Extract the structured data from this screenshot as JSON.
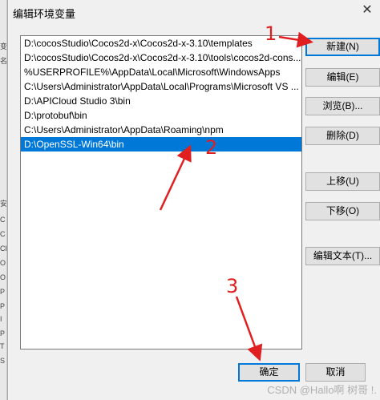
{
  "dialog": {
    "title": "编辑环境变量",
    "close_glyph": "✕"
  },
  "path_list": [
    {
      "text": "D:\\cocosStudio\\Cocos2d-x\\Cocos2d-x-3.10\\templates",
      "selected": false
    },
    {
      "text": "D:\\cocosStudio\\Cocos2d-x\\Cocos2d-x-3.10\\tools\\cocos2d-cons...",
      "selected": false
    },
    {
      "text": "%USERPROFILE%\\AppData\\Local\\Microsoft\\WindowsApps",
      "selected": false
    },
    {
      "text": "C:\\Users\\Administrator\\AppData\\Local\\Programs\\Microsoft VS ...",
      "selected": false
    },
    {
      "text": "D:\\APICloud Studio 3\\bin",
      "selected": false
    },
    {
      "text": "D:\\protobuf\\bin",
      "selected": false
    },
    {
      "text": "C:\\Users\\Administrator\\AppData\\Roaming\\npm",
      "selected": false
    },
    {
      "text": "D:\\OpenSSL-Win64\\bin",
      "selected": true
    }
  ],
  "buttons": {
    "new": "新建(N)",
    "edit": "编辑(E)",
    "browse": "浏览(B)...",
    "delete": "删除(D)",
    "move_up": "上移(U)",
    "move_down": "下移(O)",
    "edit_text": "编辑文本(T)...",
    "ok": "确定",
    "cancel": "取消"
  },
  "annotations": {
    "step1": "1",
    "step2": "2",
    "step3": "3",
    "color": "#e02020"
  },
  "background_window": {
    "fragments": [
      "变",
      "名",
      "安",
      "C",
      "C",
      "Ch",
      "O",
      "O",
      "P",
      "P",
      "I",
      "P",
      "T",
      "S"
    ]
  },
  "watermark": "CSDN @Hallo啊 树哥 !."
}
